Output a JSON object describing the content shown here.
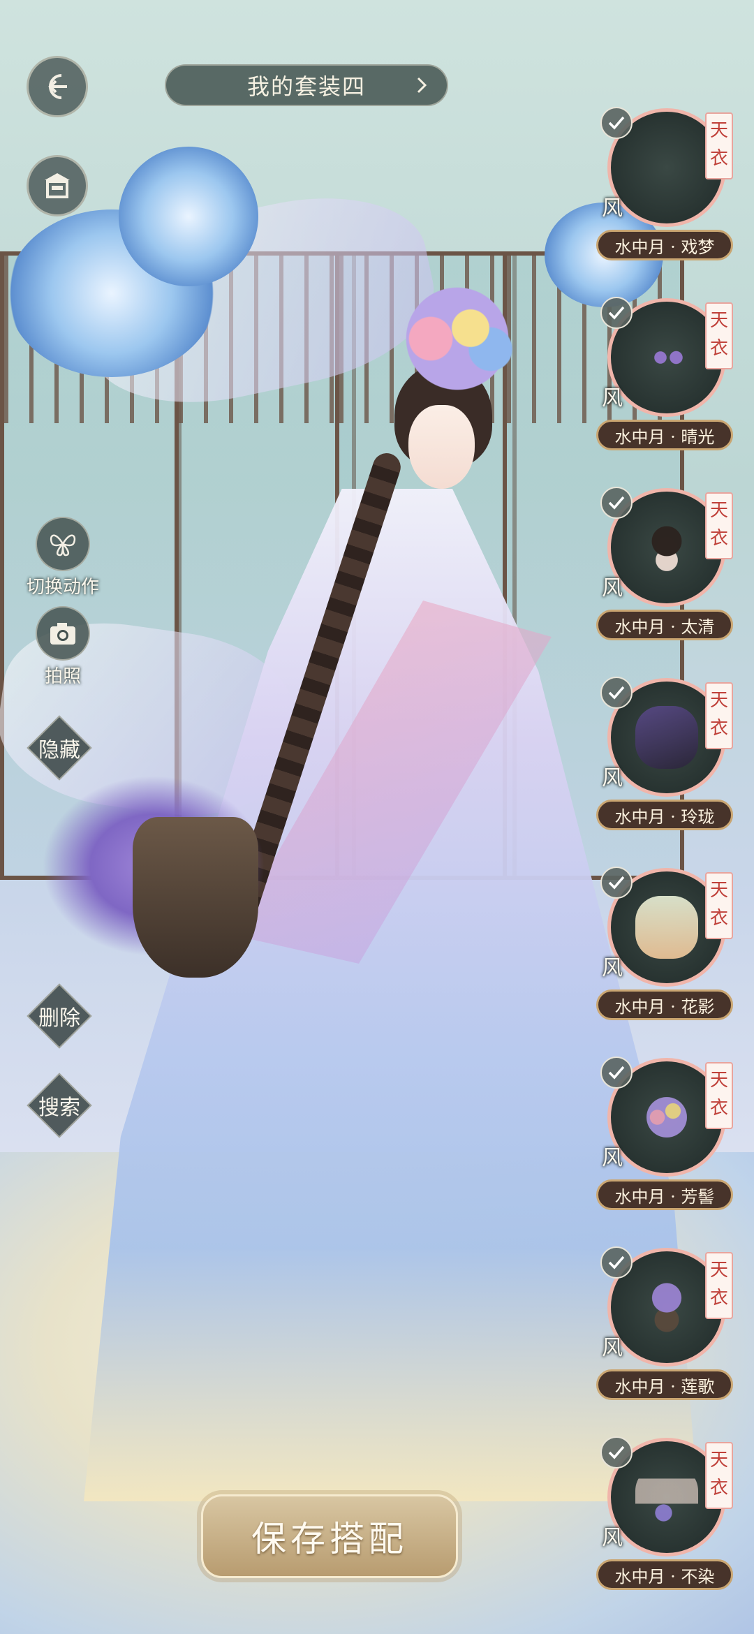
{
  "header": {
    "title": "我的套装四"
  },
  "left_actions": {
    "switch_pose": "切换动作",
    "photo": "拍照",
    "hide": "隐藏",
    "delete": "删除",
    "search": "搜索"
  },
  "items": [
    {
      "tag": "天衣",
      "element": "风",
      "name": "水中月 · 戏梦"
    },
    {
      "tag": "天衣",
      "element": "风",
      "name": "水中月 · 晴光"
    },
    {
      "tag": "天衣",
      "element": "风",
      "name": "水中月 · 太清"
    },
    {
      "tag": "天衣",
      "element": "风",
      "name": "水中月 · 玲珑"
    },
    {
      "tag": "天衣",
      "element": "风",
      "name": "水中月 · 花影"
    },
    {
      "tag": "天衣",
      "element": "风",
      "name": "水中月 · 芳髻"
    },
    {
      "tag": "天衣",
      "element": "风",
      "name": "水中月 · 莲歌"
    },
    {
      "tag": "天衣",
      "element": "风",
      "name": "水中月 · 不染"
    }
  ],
  "footer": {
    "save_label": "保存搭配"
  },
  "icons": {
    "back": "back-arrow-icon",
    "wardrobe": "wardrobe-icon",
    "pose": "butterfly-icon",
    "camera": "camera-icon",
    "check": "check-icon",
    "next": "chevron-right-icon"
  },
  "colors": {
    "tag_text": "#c0413a",
    "name_plate": "#47332a",
    "save_button": "#c8b08a"
  }
}
